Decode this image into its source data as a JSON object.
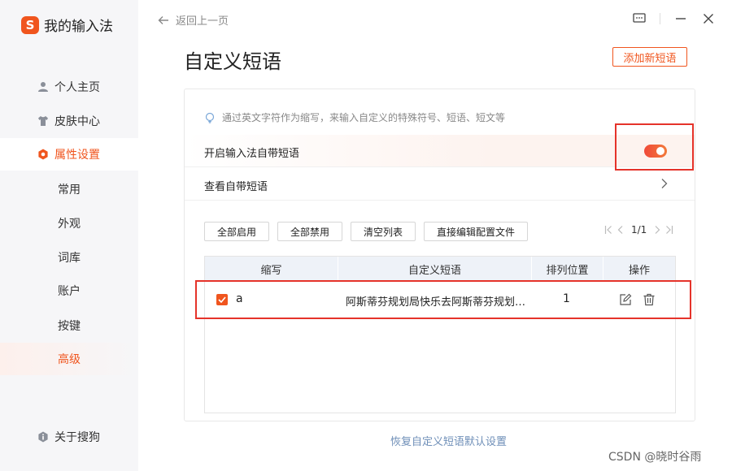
{
  "app": {
    "logo_char": "S",
    "title": "我的输入法"
  },
  "sidebar": {
    "items": [
      {
        "label": "个人主页",
        "icon": "user-icon"
      },
      {
        "label": "皮肤中心",
        "icon": "shirt-icon"
      },
      {
        "label": "属性设置",
        "icon": "hexagon-settings-icon",
        "active": true
      },
      {
        "label": "关于搜狗",
        "icon": "info-icon"
      }
    ],
    "sub_items": [
      "常用",
      "外观",
      "词库",
      "账户",
      "按键",
      "高级"
    ],
    "current_sub": "高级"
  },
  "topbar": {
    "back_label": "返回上一页"
  },
  "page": {
    "title": "自定义短语",
    "add_button": "添加新短语",
    "hint": "通过英文字符作为缩写，来输入自定义的特殊符号、短语、短文等",
    "enable_label": "开启输入法自带短语",
    "enable_on": true,
    "view_label": "查看自带短语"
  },
  "toolbar": {
    "enable_all": "全部启用",
    "disable_all": "全部禁用",
    "clear_list": "清空列表",
    "edit_config": "直接编辑配置文件"
  },
  "pager": {
    "text": "1/1"
  },
  "table": {
    "headers": [
      "缩写",
      "自定义短语",
      "排列位置",
      "操作"
    ],
    "rows": [
      {
        "checked": true,
        "abbr": "a",
        "phrase": "阿斯蒂芬规划局快乐去阿斯蒂芬规划局快乐去",
        "position": "1"
      }
    ]
  },
  "footer": {
    "restore_link": "恢复自定义短语默认设置"
  },
  "watermark": "CSDN @晓时谷雨",
  "colors": {
    "accent": "#f0551e",
    "highlight_box": "#e5332a",
    "link": "#6f8fb8"
  }
}
